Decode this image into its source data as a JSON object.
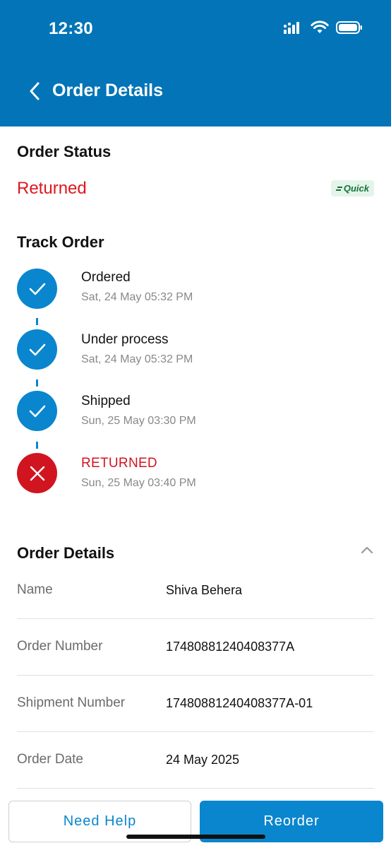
{
  "status_bar": {
    "time": "12:30"
  },
  "header": {
    "title": "Order Details",
    "back_icon": "chevron-left-icon"
  },
  "order_status": {
    "title": "Order Status",
    "status": "Returned",
    "badge": "Quick",
    "badge_color": "#14753A",
    "status_color": "#E0161E"
  },
  "track_order": {
    "title": "Track Order",
    "steps": [
      {
        "label": "Ordered",
        "time": "Sat, 24 May 05:32 PM",
        "state": "done"
      },
      {
        "label": "Under process",
        "time": "Sat, 24 May 05:32 PM",
        "state": "done"
      },
      {
        "label": "Shipped",
        "time": "Sun, 25 May 03:30 PM",
        "state": "done"
      },
      {
        "label": "RETURNED",
        "time": "Sun, 25 May 03:40 PM",
        "state": "failed"
      }
    ]
  },
  "order_details": {
    "title": "Order Details",
    "rows": [
      {
        "key": "Name",
        "value": "Shiva Behera"
      },
      {
        "key": "Order Number",
        "value": "17480881240408377A"
      },
      {
        "key": "Shipment Number",
        "value": "17480881240408377A-01"
      },
      {
        "key": "Order Date",
        "value": "24 May 2025"
      }
    ]
  },
  "actions": {
    "help_label": "Need Help",
    "reorder_label": "Reorder"
  },
  "colors": {
    "brand": "#0274B7",
    "accent": "#0A86CE",
    "error": "#D01520"
  }
}
